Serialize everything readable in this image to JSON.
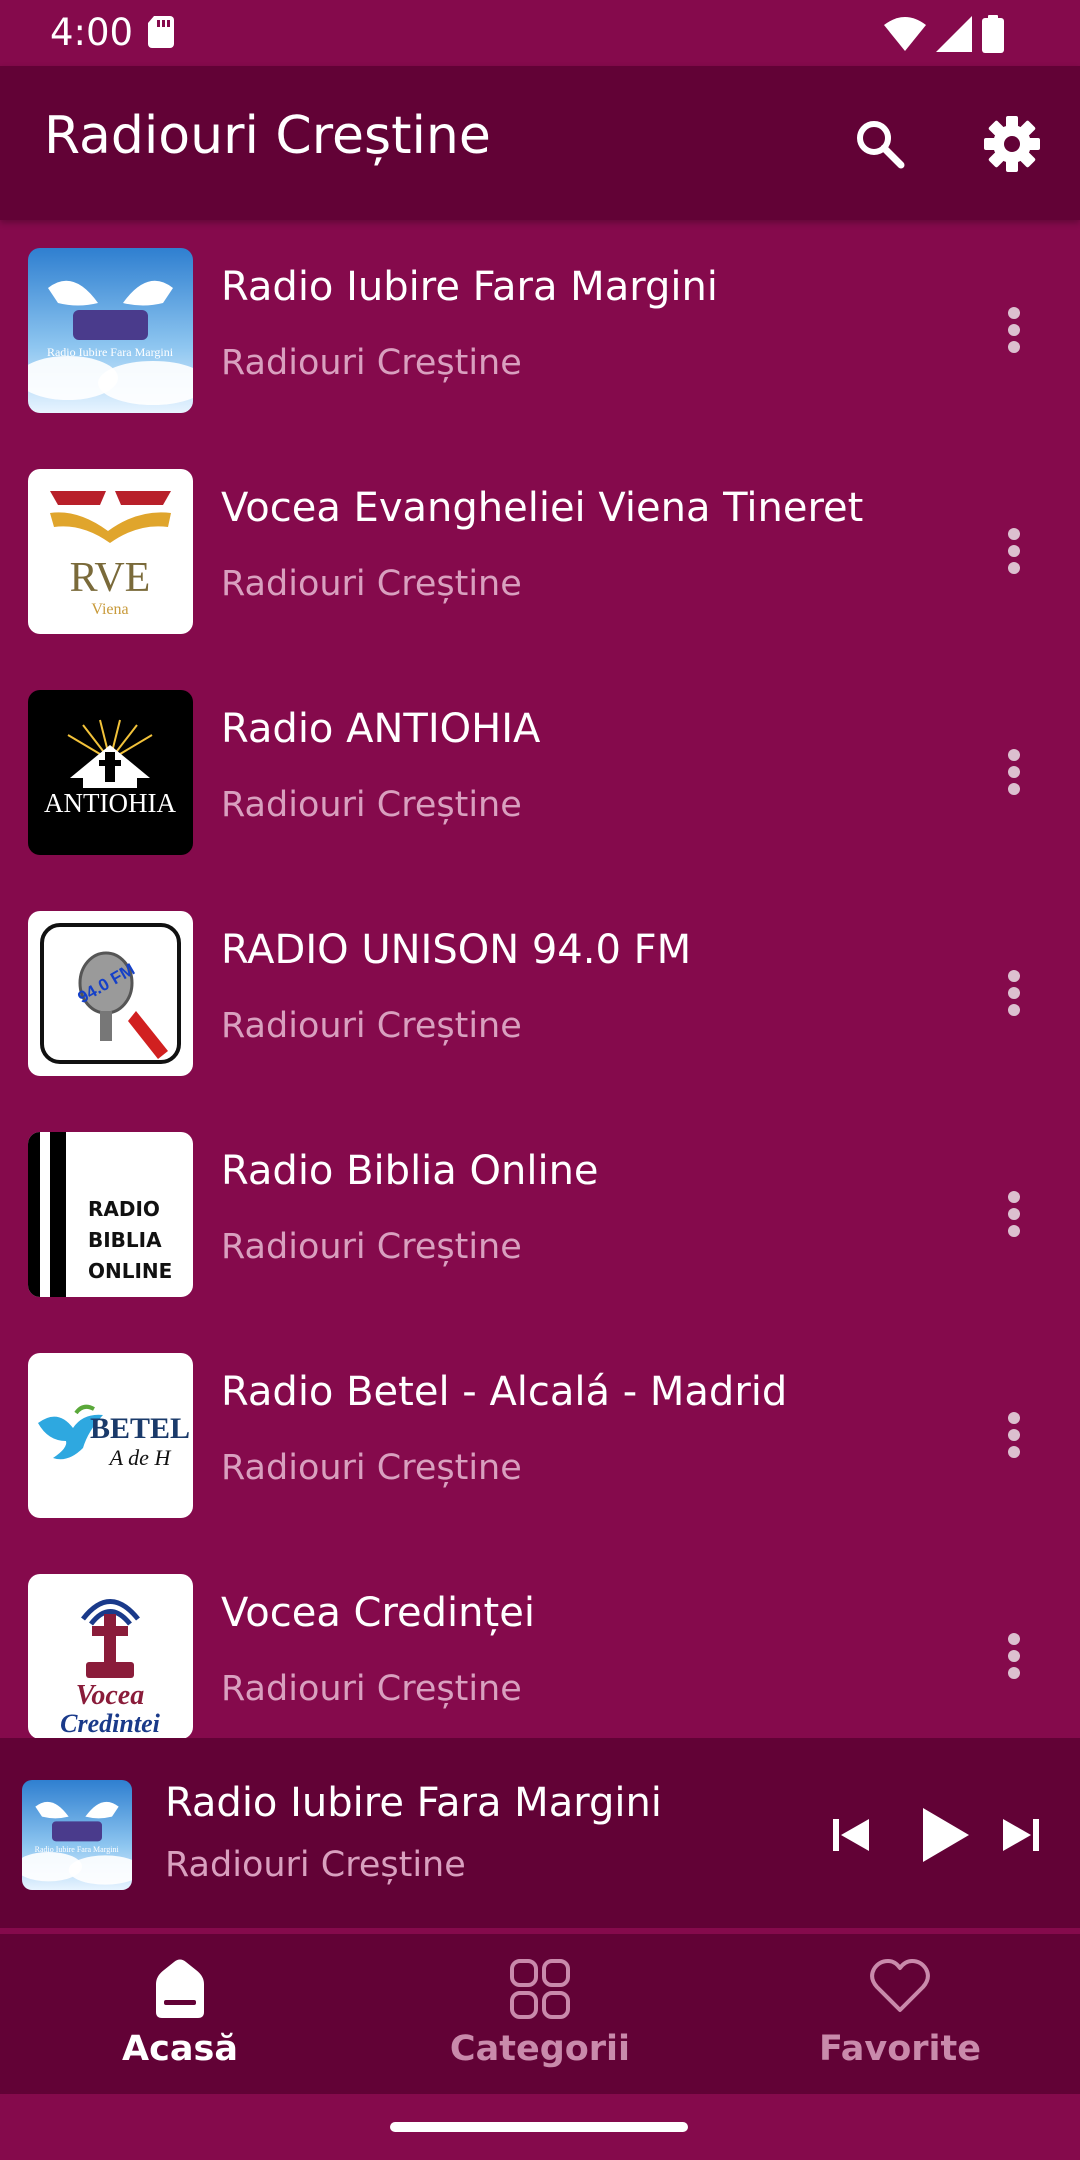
{
  "status_bar": {
    "time": "4:00",
    "icons": [
      "sd-card-icon",
      "wifi-icon",
      "signal-icon",
      "battery-icon"
    ]
  },
  "app_bar": {
    "title": "Radiouri Creștine",
    "actions": [
      "search-icon",
      "settings-gear-icon"
    ]
  },
  "stations": [
    {
      "name": "Radio Iubire Fara Margini",
      "category": "Radiouri Creștine",
      "logo_text": "Radio Iubire Fara Margini"
    },
    {
      "name": "Vocea Evangheliei Viena Tineret",
      "category": "Radiouri Creștine",
      "logo_text": "RVE",
      "logo_sub": "Viena"
    },
    {
      "name": "Radio ANTIOHIA",
      "category": "Radiouri Creștine",
      "logo_text": "ANTIOHIA"
    },
    {
      "name": "RADIO UNISON 94.0 FM",
      "category": "Radiouri Creștine",
      "logo_text": "94.0 FM"
    },
    {
      "name": "Radio Biblia Online",
      "category": "Radiouri Creștine",
      "logo_lines": [
        "RADIO",
        "BIBLIA",
        "ONLINE"
      ]
    },
    {
      "name": "Radio Betel - Alcalá - Madrid",
      "category": "Radiouri Creștine",
      "logo_text": "BETEL",
      "logo_sub": "A de H"
    },
    {
      "name": "Vocea Credinței",
      "category": "Radiouri Creștine",
      "logo_lines": [
        "Vocea",
        "Credintei"
      ]
    }
  ],
  "player": {
    "title": "Radio Iubire Fara Margini",
    "subtitle": "Radiouri Creștine",
    "state": "paused"
  },
  "bottom_nav": {
    "items": [
      {
        "label": "Acasă",
        "icon": "home-icon",
        "active": true
      },
      {
        "label": "Categorii",
        "icon": "categories-grid-icon",
        "active": false
      },
      {
        "label": "Favorite",
        "icon": "heart-icon",
        "active": false
      }
    ]
  },
  "colors": {
    "background": "#850a4c",
    "app_bar": "#620236",
    "primary_text": "#ffffff",
    "secondary_text": "#d9a0bf",
    "inactive_nav": "#c98aab"
  }
}
